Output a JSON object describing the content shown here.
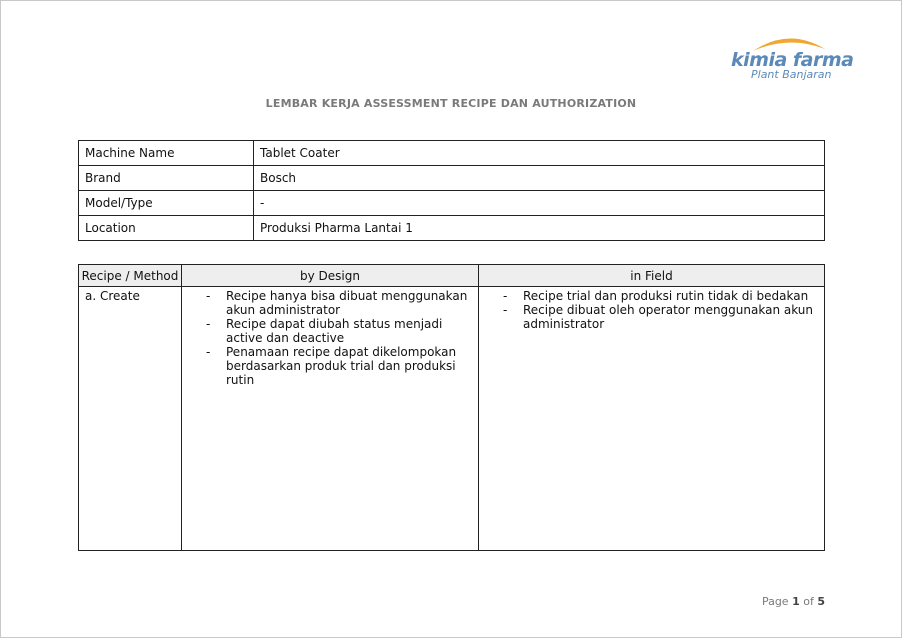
{
  "logo": {
    "brand": "kimia farma",
    "sub": "Plant Banjaran",
    "arc_color": "#f0a830",
    "text_color": "#5b8ab8"
  },
  "title": "LEMBAR KERJA ASSESSMENT RECIPE DAN AUTHORIZATION",
  "info": [
    {
      "label": "Machine Name",
      "value": "Tablet Coater"
    },
    {
      "label": "Brand",
      "value": "Bosch"
    },
    {
      "label": "Model/Type",
      "value": "-"
    },
    {
      "label": "Location",
      "value": "Produksi Pharma Lantai 1"
    }
  ],
  "table": {
    "headers": [
      "Recipe / Method",
      "by Design",
      "in Field"
    ],
    "rows": [
      {
        "method": "a. Create",
        "design": [
          "Recipe hanya bisa dibuat menggunakan akun administrator",
          "Recipe dapat diubah status menjadi active dan deactive",
          "Penamaan recipe dapat dikelompokan berdasarkan produk trial dan produksi rutin"
        ],
        "field": [
          "Recipe trial dan produksi rutin tidak di bedakan",
          "Recipe dibuat oleh operator menggunakan akun administrator"
        ]
      }
    ]
  },
  "footer": {
    "page_word": "Page",
    "current": "1",
    "of_word": "of",
    "total": "5"
  }
}
